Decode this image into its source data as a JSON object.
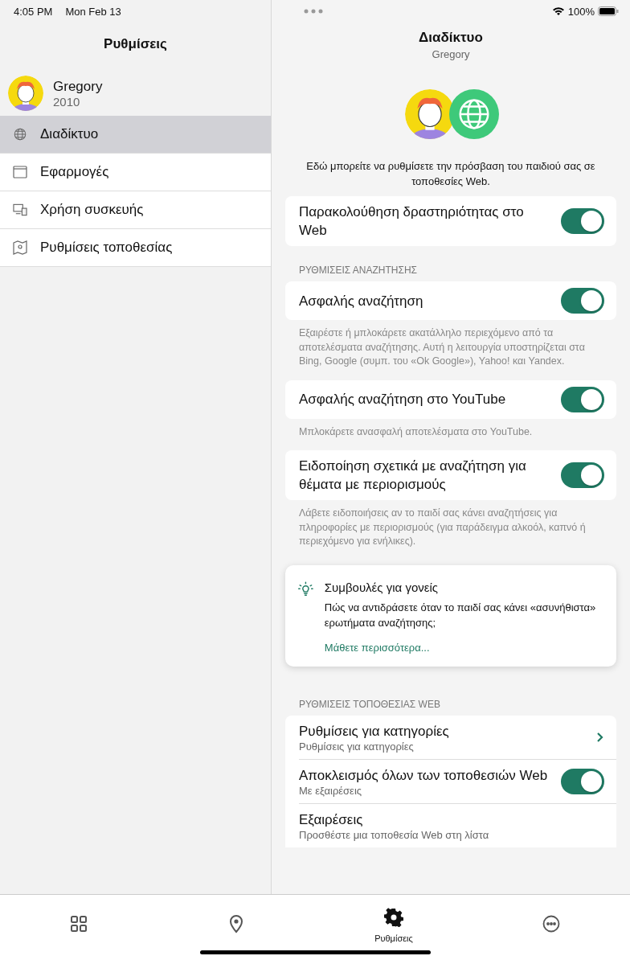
{
  "status_bar": {
    "time": "4:05 PM",
    "date": "Mon Feb 13",
    "battery": "100%"
  },
  "sidebar": {
    "title": "Ρυθμίσεις",
    "profile": {
      "name": "Gregory",
      "year": "2010"
    },
    "items": [
      {
        "label": "Διαδίκτυο",
        "selected": true
      },
      {
        "label": "Εφαρμογές",
        "selected": false
      },
      {
        "label": "Χρήση συσκευής",
        "selected": false
      },
      {
        "label": "Ρυθμίσεις τοποθεσίας",
        "selected": false
      }
    ]
  },
  "detail": {
    "title": "Διαδίκτυο",
    "subtitle": "Gregory",
    "description": "Εδώ μπορείτε να ρυθμίσετε την πρόσβαση του παιδιού σας σε τοποθεσίες Web.",
    "top_toggle": {
      "label": "Παρακολούθηση δραστηριότητας στο Web",
      "on": true
    },
    "search_section": {
      "header": "ΡΥΘΜΙΣΕΙΣ ΑΝΑΖΗΤΗΣΗΣ",
      "items": [
        {
          "label": "Ασφαλής αναζήτηση",
          "on": true,
          "note": "Εξαιρέστε ή μπλοκάρετε ακατάλληλο περιεχόμενο από τα αποτελέσματα αναζήτησης. Αυτή η λειτουργία υποστηρίζεται στα Bing, Google (συμπ. του «Ok Google»), Yahoo! και Yandex."
        },
        {
          "label": "Ασφαλής αναζήτηση στο YouTube",
          "on": true,
          "note": "Μπλοκάρετε ανασφαλή αποτελέσματα στο YouTube."
        },
        {
          "label": "Ειδοποίηση σχετικά με αναζήτηση για θέματα με περιορισμούς",
          "on": true,
          "note": "Λάβετε ειδοποιήσεις αν το παιδί σας κάνει αναζητήσεις για πληροφορίες με περιορισμούς (για παράδειγμα αλκοόλ, καπνό ή περιεχόμενο για ενήλικες)."
        }
      ]
    },
    "tip": {
      "title": "Συμβουλές για γονείς",
      "text": "Πώς να αντιδράσετε όταν το παιδί σας κάνει «ασυνήθιστα» ερωτήματα αναζήτησης;",
      "link": "Μάθετε περισσότερα..."
    },
    "web_section": {
      "header": "ΡΥΘΜΙΣΕΙΣ ΤΟΠΟΘΕΣΙΑΣ WEB",
      "rows": [
        {
          "kind": "link",
          "label": "Ρυθμίσεις για κατηγορίες",
          "sublabel": "Ρυθμίσεις για κατηγορίες"
        },
        {
          "kind": "toggle",
          "label": "Αποκλεισμός όλων των τοποθεσιών Web",
          "sublabel": "Με εξαιρέσεις",
          "on": true
        },
        {
          "kind": "plain",
          "label": "Εξαιρέσεις",
          "sublabel": "Προσθέστε μια τοποθεσία Web στη λίστα"
        }
      ]
    }
  },
  "tab_bar": {
    "items": [
      {
        "selected": false
      },
      {
        "selected": false
      },
      {
        "label": "Ρυθμίσεις",
        "selected": true
      },
      {
        "selected": false
      }
    ]
  }
}
